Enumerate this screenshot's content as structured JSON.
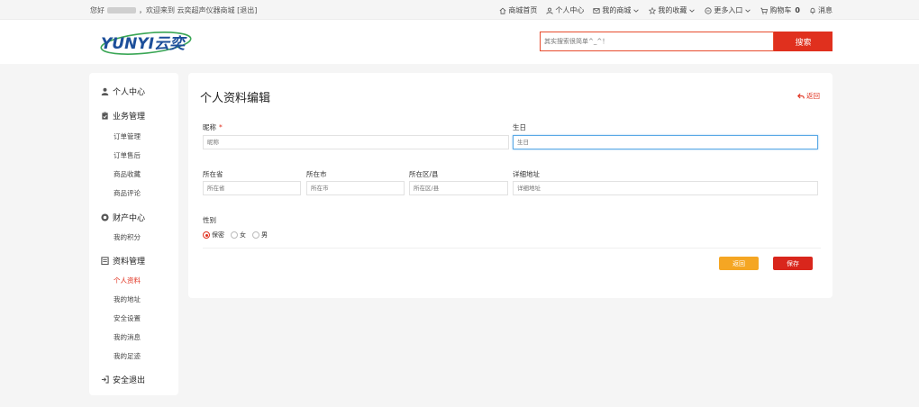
{
  "topbar": {
    "greeting_prefix": "您好",
    "welcome": "，欢迎来到 云奕超声仪器商城",
    "logout": "[退出]",
    "links": {
      "home": "商城首页",
      "personal": "个人中心",
      "mall": "我的商城",
      "favorites": "我的收藏",
      "more": "更多入口",
      "cart": "购物车",
      "cart_count": "0",
      "messages": "消息"
    }
  },
  "header": {
    "logo_text": "YUNYI云奕",
    "search_placeholder": "其实搜索很简单^_^！",
    "search_button": "搜索"
  },
  "sidebar": {
    "personal_center": "个人中心",
    "business": "业务管理",
    "orders": "订单管理",
    "after_sales": "订单售后",
    "product_favorites": "商品收藏",
    "product_reviews": "商品评论",
    "finance": "财产中心",
    "my_points": "我的积分",
    "profile_mgmt": "资料管理",
    "personal_info": "个人资料",
    "my_address": "我的地址",
    "security": "安全设置",
    "my_messages": "我的消息",
    "my_footprints": "我的足迹",
    "safe_logout": "安全退出"
  },
  "form": {
    "title": "个人资料编辑",
    "back_link": "返回",
    "nickname_label": "昵称",
    "required_mark": "*",
    "nickname_placeholder": "昵称",
    "birthday_label": "生日",
    "birthday_placeholder": "生日",
    "province_label": "所在省",
    "province_placeholder": "所在省",
    "city_label": "所在市",
    "city_placeholder": "所在市",
    "district_label": "所在区/县",
    "district_placeholder": "所在区/县",
    "address_label": "详细地址",
    "address_placeholder": "详细地址",
    "gender_label": "性别",
    "gender_secret": "保密",
    "gender_female": "女",
    "gender_male": "男",
    "back_button": "返回",
    "save_button": "保存"
  },
  "colors": {
    "accent": "#e0301e",
    "back_button": "#f5a623",
    "focus_border": "#5aa9e6"
  }
}
